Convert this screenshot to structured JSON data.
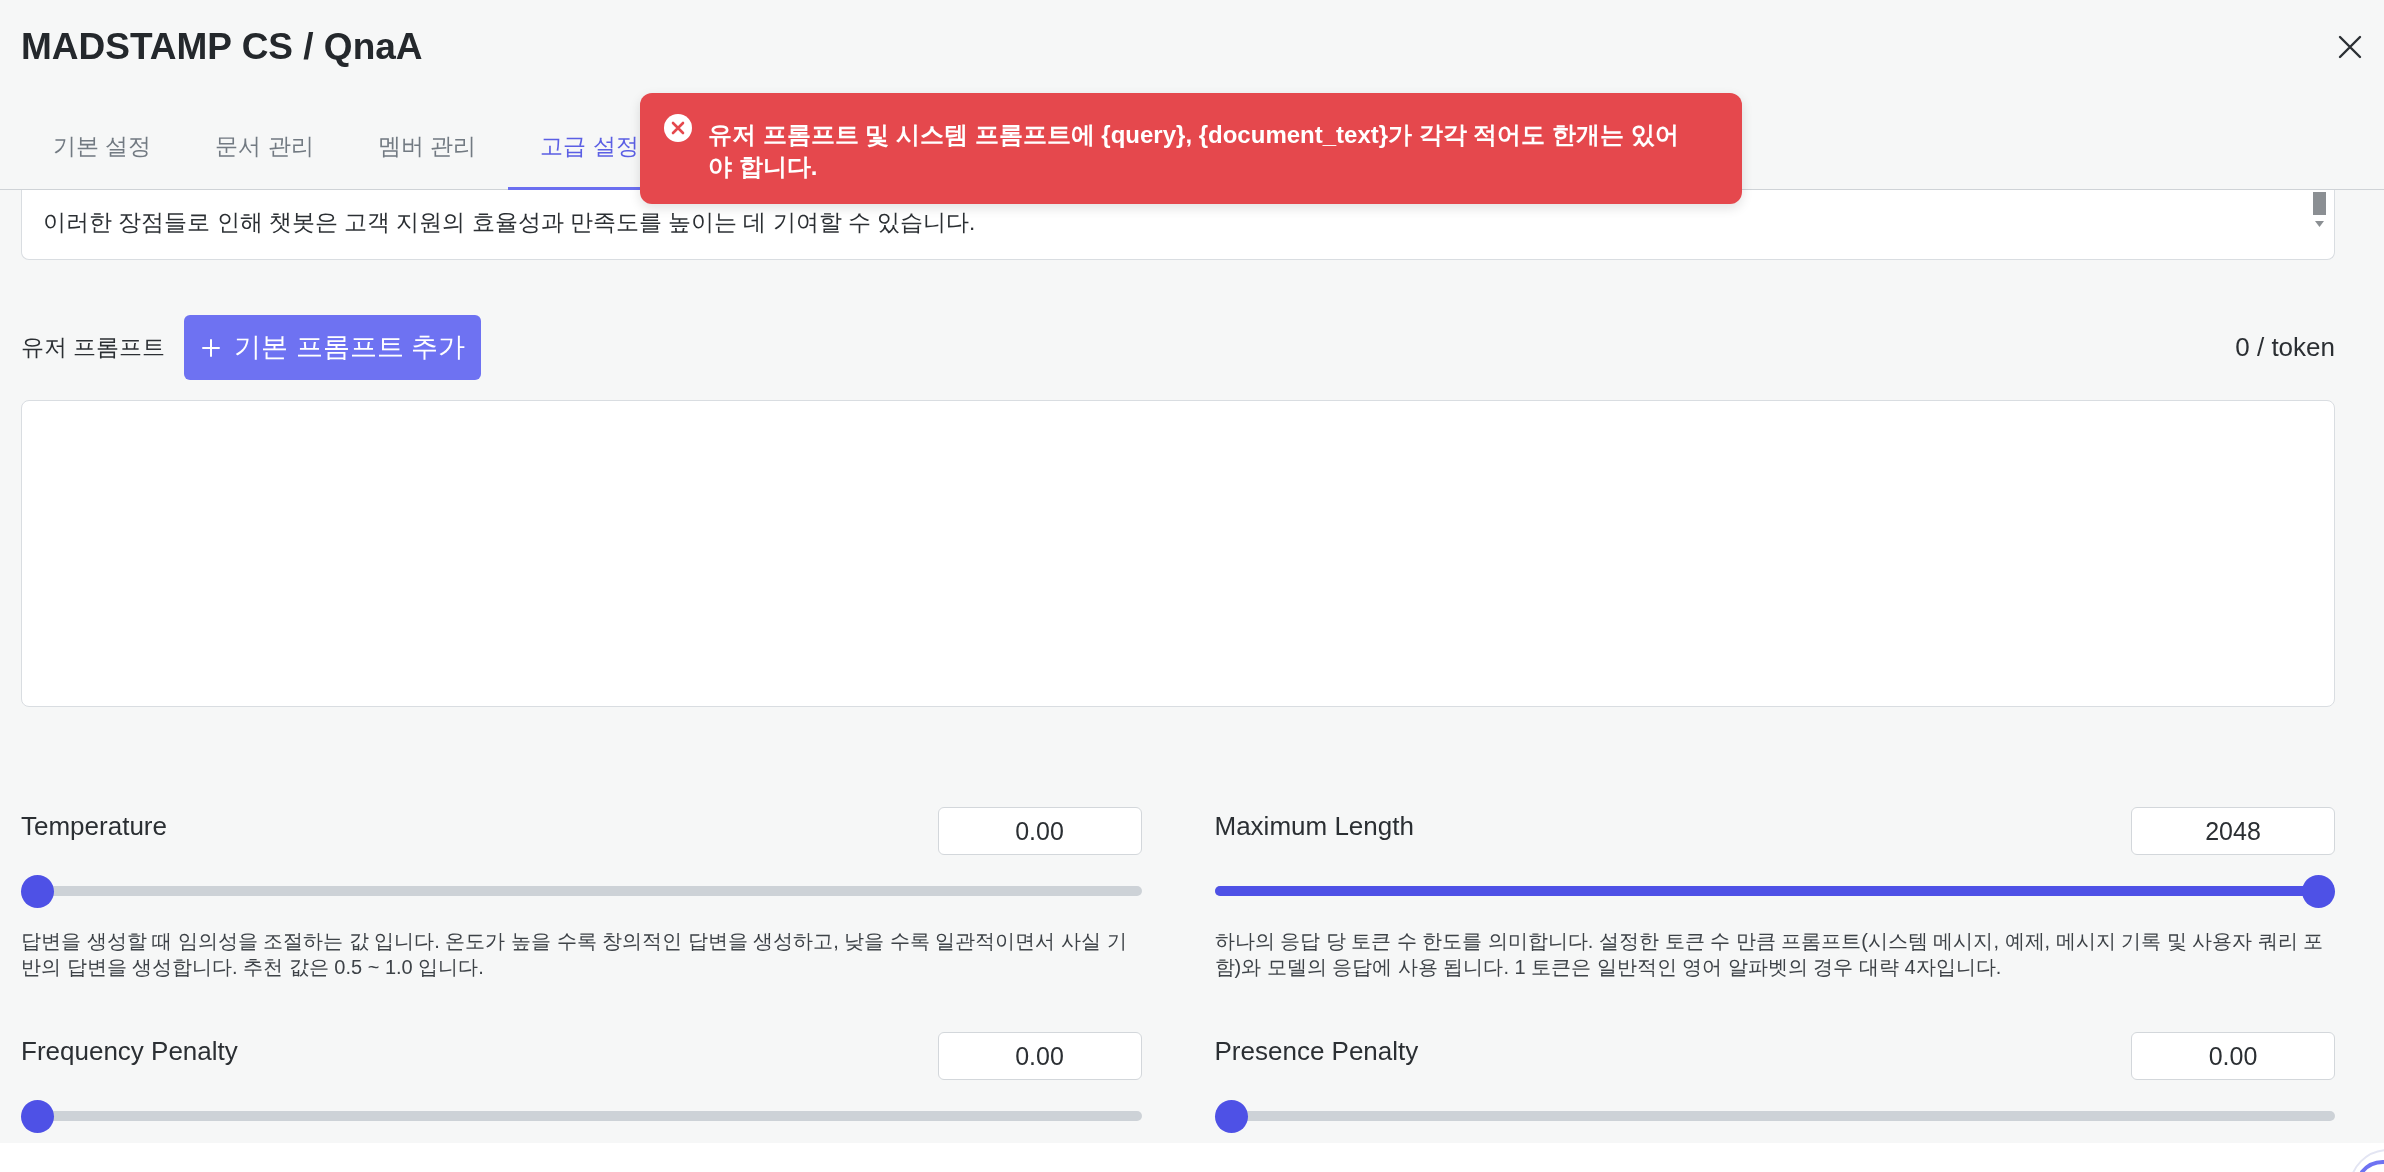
{
  "window": {
    "title": "MADSTAMP CS / QnaA"
  },
  "tabs": [
    {
      "label": "기본 설정",
      "selected": false
    },
    {
      "label": "문서 관리",
      "selected": false
    },
    {
      "label": "멤버 관리",
      "selected": false
    },
    {
      "label": "고급 설정",
      "selected": true
    }
  ],
  "system_prompt": {
    "value": "이러한 장점들로 인해 챗봇은 고객 지원의 효율성과 만족도를 높이는 데 기여할 수 있습니다."
  },
  "user_prompt": {
    "label": "유저 프롬프트",
    "add_button": "기본 프롬프트 추가",
    "token_count": "0 / token"
  },
  "parameters": [
    {
      "label": "Temperature",
      "value": "0.00",
      "level": 0,
      "description": "답변을 생성할 때 임의성을 조절하는 값 입니다. 온도가 높을 수록 창의적인 답변을 생성하고, 낮을 수록 일관적이면서 사실 기반의 답변을 생성합니다. 추천 값은 0.5 ~ 1.0 입니다."
    },
    {
      "label": "Maximum Length",
      "value": "2048",
      "level": 1,
      "description": "하나의 응답 당 토큰 수 한도를 의미합니다. 설정한 토큰 수 만큼 프롬프트(시스템 메시지, 예제, 메시지 기록 및 사용자 쿼리 포함)와 모델의 응답에 사용 됩니다. 1 토큰은 일반적인 영어 알파벳의 경우 대략 4자입니다."
    },
    {
      "label": "Frequency Penalty",
      "value": "0.00",
      "level": 0
    },
    {
      "label": "Presence Penalty",
      "value": "0.00",
      "level": 0
    }
  ],
  "toast": {
    "kind": "error",
    "message": "유저 프롬프트 및 시스템 프롬프트에 {query}, {document_text}가 각각 적어도 한개는 있어야 합니다."
  }
}
